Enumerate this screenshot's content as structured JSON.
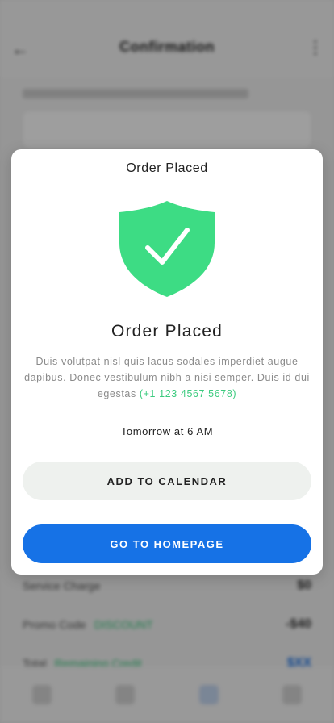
{
  "background": {
    "header_title": "Confirmation",
    "summary_rows": [
      {
        "label": "Service Charge",
        "value": "$0"
      },
      {
        "label": "Promo Code",
        "promo": "DISCOUNT",
        "value": "-$40"
      },
      {
        "label": "Total",
        "promo": "Remaining Credit",
        "value": "$XX"
      }
    ]
  },
  "modal": {
    "header": "Order Placed",
    "icon": "shield-check-icon",
    "title": "Order Placed",
    "body_text": "Duis volutpat nisl quis lacus sodales imperdiet augue dapibus. Donec vestibulum nibh a nisi semper. Duis id dui egestas",
    "phone": "(+1 123 4567 5678)",
    "time": "Tomorrow at 6 AM",
    "calendar_button": "ADD TO CALENDAR",
    "home_button": "GO TO HOMEPAGE"
  },
  "colors": {
    "shield": "#3ddc84",
    "primary": "#1672e6",
    "accent_green": "#3ccb7f"
  }
}
